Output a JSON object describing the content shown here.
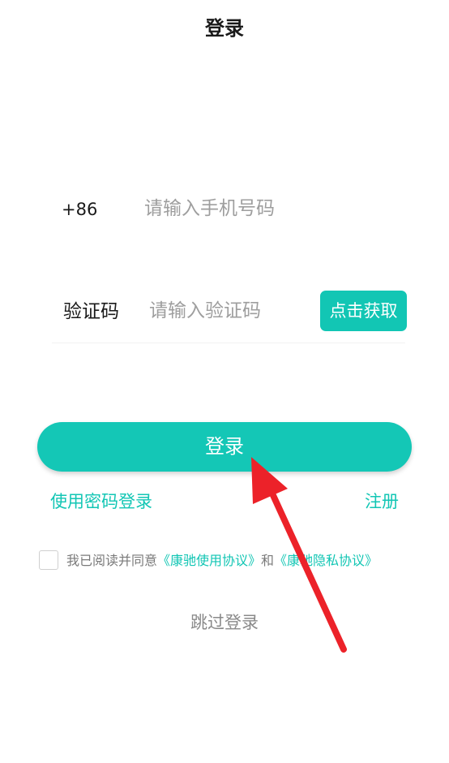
{
  "header": {
    "title": "登录"
  },
  "phone": {
    "prefix": "+86",
    "placeholder": "请输入手机号码",
    "value": ""
  },
  "code": {
    "label": "验证码",
    "placeholder": "请输入验证码",
    "value": "",
    "get_code_label": "点击获取"
  },
  "actions": {
    "login_label": "登录",
    "password_login_label": "使用密码登录",
    "register_label": "注册",
    "skip_label": "跳过登录"
  },
  "agreement": {
    "checked": false,
    "prefix_text": "我已阅读并同意",
    "terms_link": "《康驰使用协议》",
    "and_text": "和",
    "privacy_link": "《康驰隐私协议》"
  },
  "colors": {
    "accent": "#14c7b6",
    "annotation_arrow": "#ec2229"
  },
  "icons": {
    "annotation": "arrow-pointer-icon"
  }
}
